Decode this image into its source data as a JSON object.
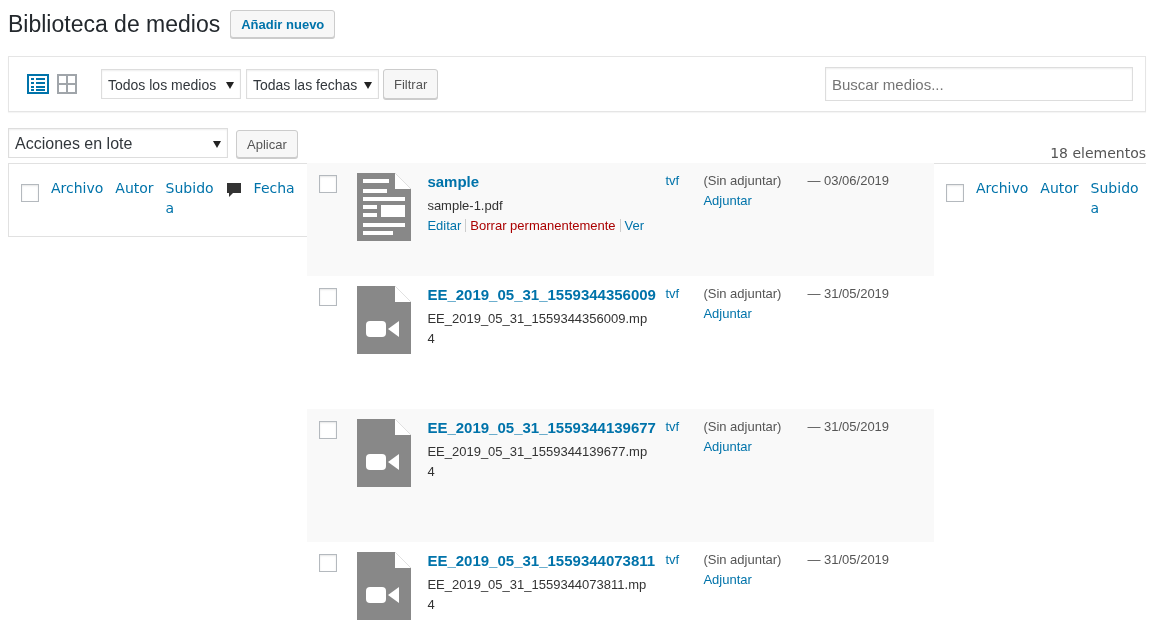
{
  "page_title": "Biblioteca de medios",
  "add_button": "Añadir nuevo",
  "filters": {
    "views": [
      {
        "kind": "list",
        "selected": true
      },
      {
        "kind": "grid",
        "selected": false
      }
    ],
    "media_type": "Todos los medios",
    "dates": "Todas las fechas",
    "filter_button": "Filtrar",
    "search": {
      "placeholder": "Buscar medios..."
    }
  },
  "bulk": {
    "action": "Acciones en lote",
    "apply": "Aplicar",
    "count": "18 elementos"
  },
  "left_header": {
    "checked": false,
    "columns": [
      {
        "kind": "text",
        "label": "Archivo"
      },
      {
        "kind": "text",
        "label": "Autor"
      },
      {
        "kind": "text",
        "label": "Subido a"
      },
      {
        "kind": "comments"
      },
      {
        "kind": "text",
        "label": "Fecha"
      }
    ]
  },
  "right_header": {
    "checked": false,
    "columns": [
      {
        "kind": "text",
        "label": "Archivo"
      },
      {
        "kind": "text",
        "label": "Autor"
      },
      {
        "kind": "text",
        "label": "Subido a"
      }
    ]
  },
  "rows": [
    {
      "checked": false,
      "kind": "document",
      "title": "sample",
      "filename": "sample-1.pdf",
      "author": "tvf",
      "attached": "(Sin adjuntar)",
      "attach": "Adjuntar",
      "date": "— 03/06/2019",
      "actions": [
        {
          "kind": "edit",
          "label": "Editar"
        },
        {
          "kind": "delete",
          "label": "Borrar permanentemente"
        },
        {
          "kind": "view",
          "label": "Ver"
        }
      ]
    },
    {
      "checked": false,
      "kind": "video",
      "title": "EE_2019_05_31_1559344356009",
      "filename": "EE_2019_05_31_1559344356009.mp4",
      "author": "tvf",
      "attached": "(Sin adjuntar)",
      "attach": "Adjuntar",
      "date": "— 31/05/2019"
    },
    {
      "checked": false,
      "kind": "video",
      "title": "EE_2019_05_31_1559344139677",
      "filename": "EE_2019_05_31_1559344139677.mp4",
      "author": "tvf",
      "attached": "(Sin adjuntar)",
      "attach": "Adjuntar",
      "date": "— 31/05/2019"
    },
    {
      "checked": false,
      "kind": "video",
      "title": "EE_2019_05_31_1559344073811",
      "filename": "EE_2019_05_31_1559344073811.mp4",
      "author": "tvf",
      "attached": "(Sin adjuntar)",
      "attach": "Adjuntar",
      "date": "— 31/05/2019"
    }
  ]
}
